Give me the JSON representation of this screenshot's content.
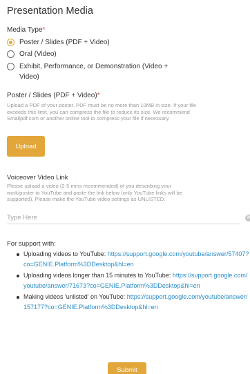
{
  "section_title": "Presentation Media",
  "media_type": {
    "label": "Media Type",
    "required_mark": "*",
    "options": [
      {
        "label": "Poster / Slides (PDF + Video)",
        "checked": true
      },
      {
        "label": "Oral (Video)",
        "checked": false
      },
      {
        "label_line1": "Exhibit, Performance, or Demonstration (Video +",
        "label_line2": "Video)",
        "checked": false
      }
    ]
  },
  "poster_upload": {
    "label": "Poster / Slides (PDF + Video)",
    "required_mark": "*",
    "help_lines": [
      "Upload a PDF of your poster. PDF must be no more than 10MB in size. If your file",
      "exceeds this limit, you can compress the file to reduce its size. We recommend",
      "Smallpdf.com or another online tool to compress your file if necessary."
    ],
    "button_label": "Upload"
  },
  "voiceover": {
    "label": "Voiceover Video Link",
    "help_lines": [
      "Please upload a video (2-5 mins recommended) of you describing your",
      "work/poster to YouTube and paste the link below (only YouTube links will be",
      "supported). Please make the YouTube video settings as UNLISTED."
    ],
    "input_value": "",
    "input_placeholder": "Type Here"
  },
  "support": {
    "title": "For support with:",
    "items": [
      {
        "text": "Uploading videos to YouTube: ",
        "link": "https://support.google.com/youtube/answer/57407?co=GENIE.Platform%3DDesktop&hl=en"
      },
      {
        "text": "Uploading videos longer than 15 minutes to YouTube: ",
        "link": "https://support.google.com/youtube/answer/71673?co=GENIE.Platform%3DDesktop&hl=en"
      },
      {
        "text": "Making videos 'unlisted' on YouTube: ",
        "link": "https://support.google.com/youtube/answer/157177?co=GENIE.Platform%3DDesktop&hl=en"
      }
    ]
  },
  "submit_label": "Submit",
  "colors": {
    "accent": "#e3a63a",
    "link": "#2a8dc8",
    "required": "#d9534f",
    "help_text": "#9a9a9a"
  }
}
